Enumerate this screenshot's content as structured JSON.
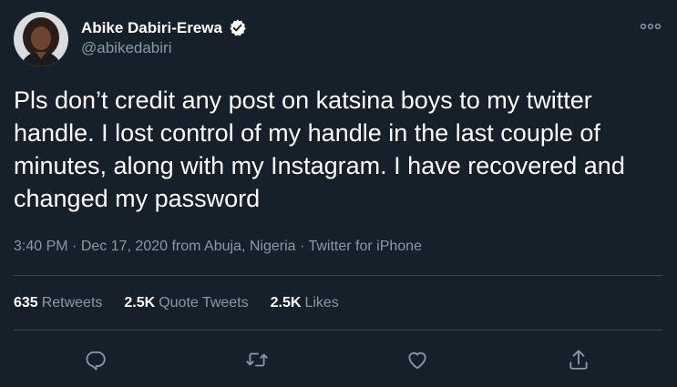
{
  "author": {
    "name": "Abike Dabiri-Erewa",
    "handle": "@abikedabiri",
    "verified": true
  },
  "tweet": {
    "text": "Pls don’t credit any post on katsina boys to my twitter handle. I lost control of my handle in the last couple of minutes, along with my Instagram. I have recovered and changed my password",
    "time": "3:40 PM",
    "date": "Dec 17, 2020",
    "location": "from Abuja, Nigeria",
    "source": "Twitter for iPhone",
    "separator": "·"
  },
  "stats": {
    "retweets_count": "635",
    "retweets_label": "Retweets",
    "quotes_count": "2.5K",
    "quotes_label": "Quote Tweets",
    "likes_count": "2.5K",
    "likes_label": "Likes"
  },
  "icons": {
    "more": "more-horizontal-icon",
    "reply": "reply-icon",
    "retweet": "retweet-icon",
    "like": "heart-icon",
    "share": "share-icon",
    "verified": "verified-badge-icon"
  },
  "colors": {
    "background": "#15202b",
    "primary_text": "#ffffff",
    "secondary_text": "#8899a6",
    "divider": "#38444d"
  }
}
